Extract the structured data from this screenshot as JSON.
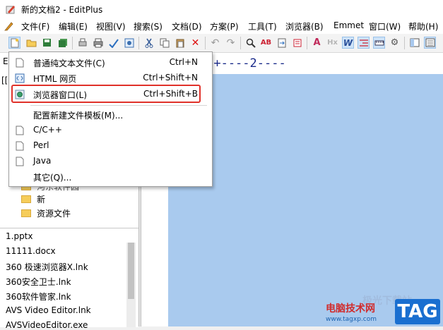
{
  "window": {
    "title": "新的文档2 - EditPlus"
  },
  "menubar": {
    "items": [
      "文件(F)",
      "编辑(E)",
      "视图(V)",
      "搜索(S)",
      "文档(D)",
      "方案(P)",
      "工具(T)",
      "浏览器(B)",
      "Emmet",
      "窗口(W)",
      "帮助(H)"
    ]
  },
  "new_menu": {
    "items": [
      {
        "label": "普通纯文本文件(C)",
        "shortcut": "Ctrl+N",
        "icon": "text-file-icon"
      },
      {
        "label": "HTML 网页",
        "shortcut": "Ctrl+Shift+N",
        "icon": "html-file-icon"
      },
      {
        "label": "浏览器窗口(L)",
        "shortcut": "Ctrl+Shift+B",
        "icon": "browser-icon"
      },
      {
        "label": "配置新建文件模板(M)...",
        "shortcut": "",
        "icon": ""
      },
      {
        "label": "C/C++",
        "shortcut": "",
        "icon": "c-file-icon"
      },
      {
        "label": "Perl",
        "shortcut": "",
        "icon": "perl-file-icon"
      },
      {
        "label": "Java",
        "shortcut": "",
        "icon": "java-file-icon"
      },
      {
        "label": "其它(Q)...",
        "shortcut": "",
        "icon": ""
      }
    ],
    "highlight_color": "#e0312a"
  },
  "directory_tree": {
    "partial_label": "河东软件园",
    "folders": [
      "新",
      "资源文件"
    ],
    "pane_labels": [
      "E",
      "[["
    ]
  },
  "file_list": {
    "items": [
      "1.pptx",
      "11111.docx",
      "360 极速浏览器X.lnk",
      "360安全卫士.lnk",
      "360软件管家.lnk",
      "AVS Video Editor.lnk",
      "AVSVideoEditor.exe"
    ]
  },
  "editor": {
    "ruler_text": "+----1----+----2----",
    "text_area_color": "#a9caee"
  },
  "watermark": {
    "site_name": "电脑技术网",
    "url": "www.tagxp.com",
    "badge": "TAG",
    "faded_text": "极光下载站"
  }
}
